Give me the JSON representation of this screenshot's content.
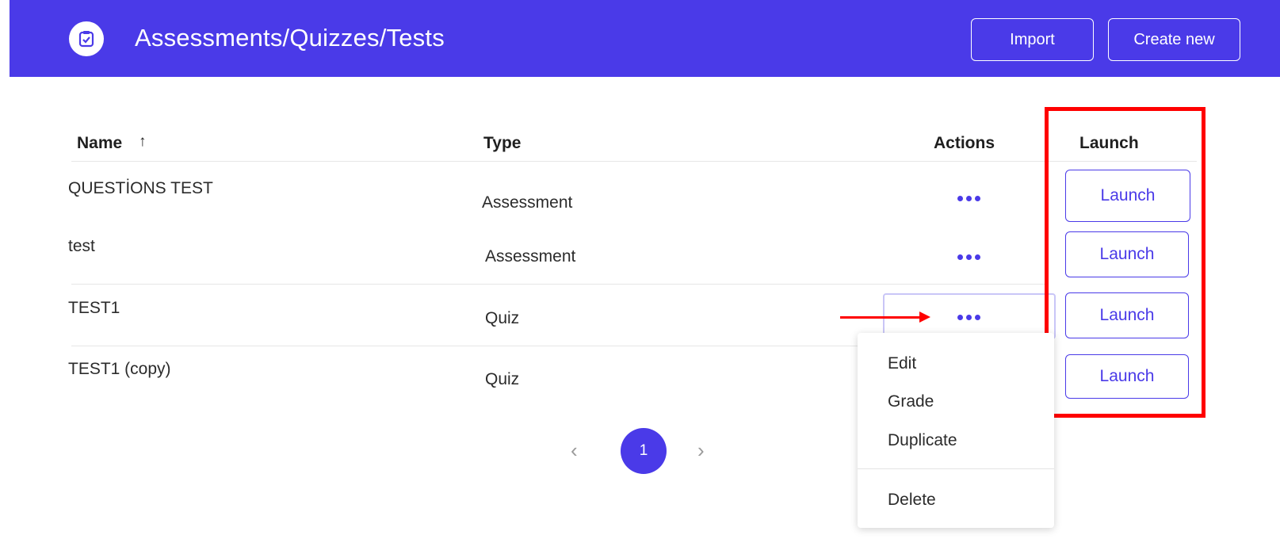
{
  "header": {
    "title": "Assessments/Quizzes/Tests",
    "import_label": "Import",
    "create_label": "Create new",
    "icon": "clipboard-check-icon"
  },
  "table": {
    "columns": [
      "Name",
      "Type",
      "Actions",
      "Launch"
    ],
    "rows": [
      {
        "name": "QUESTİONS TEST",
        "type": "Assessment",
        "launch_label": "Launch"
      },
      {
        "name": "test",
        "type": "Assessment",
        "launch_label": "Launch"
      },
      {
        "name": "TEST1",
        "type": "Quiz",
        "launch_label": "Launch"
      },
      {
        "name": "TEST1 (copy)",
        "type": "Quiz",
        "launch_label": "Launch"
      }
    ]
  },
  "actions_menu": {
    "items": [
      "Edit",
      "Grade",
      "Duplicate",
      "Delete"
    ]
  },
  "pagination": {
    "current_page": "1",
    "prev_icon": "‹",
    "next_icon": "›"
  },
  "sort_icon": "↑",
  "colors": {
    "brand": "#4a3ae8",
    "annotation": "#ff0000"
  }
}
